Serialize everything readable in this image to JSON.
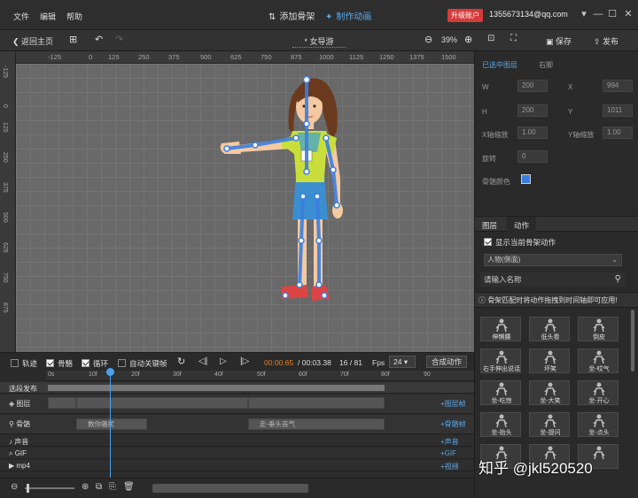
{
  "menu": {
    "file": "文件",
    "edit": "编辑",
    "help": "帮助"
  },
  "tabs": {
    "add_skeleton": "添加骨架",
    "make_animation": "制作动画"
  },
  "account": {
    "upgrade": "升级账户",
    "email": "1355673134@qq.com"
  },
  "toolbar": {
    "back": "返回主页",
    "doc_name": "* 女导游",
    "zoom": "39%",
    "save": "保存",
    "publish": "发布"
  },
  "ruler_ticks": [
    "-125",
    "0",
    "125",
    "250",
    "375",
    "500",
    "625",
    "750",
    "875",
    "1000",
    "1125",
    "1250",
    "1375",
    "1500"
  ],
  "vruler_ticks": [
    "-125",
    "0",
    "125",
    "250",
    "375",
    "500",
    "625",
    "750",
    "875"
  ],
  "right_panel": {
    "selected_label": "已选中图层",
    "selected_value": "右脚",
    "w_label": "W",
    "w": "200",
    "x_label": "X",
    "x": "994",
    "h_label": "H",
    "h": "200",
    "y_label": "Y",
    "y": "1011",
    "sx_label": "X轴缩放",
    "sx": "1.00",
    "sy_label": "Y轴缩放",
    "sy": "1.00",
    "rot_label": "旋转",
    "rot": "0",
    "bone_color_label": "骨骼颜色",
    "tab_layers": "图层",
    "tab_actions": "动作",
    "show_current": "显示当前骨架动作",
    "category": "人物(侧面)",
    "search_placeholder": "请输入名称",
    "hint": "骨架匹配时将动作拖拽到时间轴即可应用!",
    "actions": [
      "伸懒腰",
      "低头看",
      "倒皮",
      "右手伸出说话",
      "坏笑",
      "坐-哎气",
      "坐-吃惊",
      "坐-大笑",
      "坐-开心",
      "坐-抬头",
      "坐-提问",
      "坐-点头",
      "",
      "",
      ""
    ]
  },
  "timeline": {
    "trail": "轨迹",
    "bones": "骨骼",
    "loop": "循环",
    "auto_key": "自动关键帧",
    "time_current": "00:00.65",
    "time_total": "/ 00:03.38",
    "frame": "16 / 81",
    "fps_label": "Fps",
    "fps": "24",
    "compose": "合成动作",
    "ticks": [
      "0s",
      "10f",
      "20f",
      "30f",
      "40f",
      "50f",
      "60f",
      "70f",
      "80f",
      "90"
    ],
    "tracks": [
      {
        "name": "选段发布",
        "add": ""
      },
      {
        "name": "图层",
        "add": "图层帧"
      },
      {
        "name": "骨骼",
        "add": "骨骼帧"
      },
      {
        "name": "声音",
        "add": "声音"
      },
      {
        "name": "GIF",
        "add": "GIF"
      },
      {
        "name": "mp4",
        "add": "视频"
      }
    ],
    "seg1": "数你骚扰",
    "seg2": "走-垂头丧气"
  },
  "watermark": "知乎 @jkl520520",
  "colors": {
    "accent": "#5aa7e6",
    "upgrade": "#d63b3b",
    "canvas": "#696969"
  }
}
